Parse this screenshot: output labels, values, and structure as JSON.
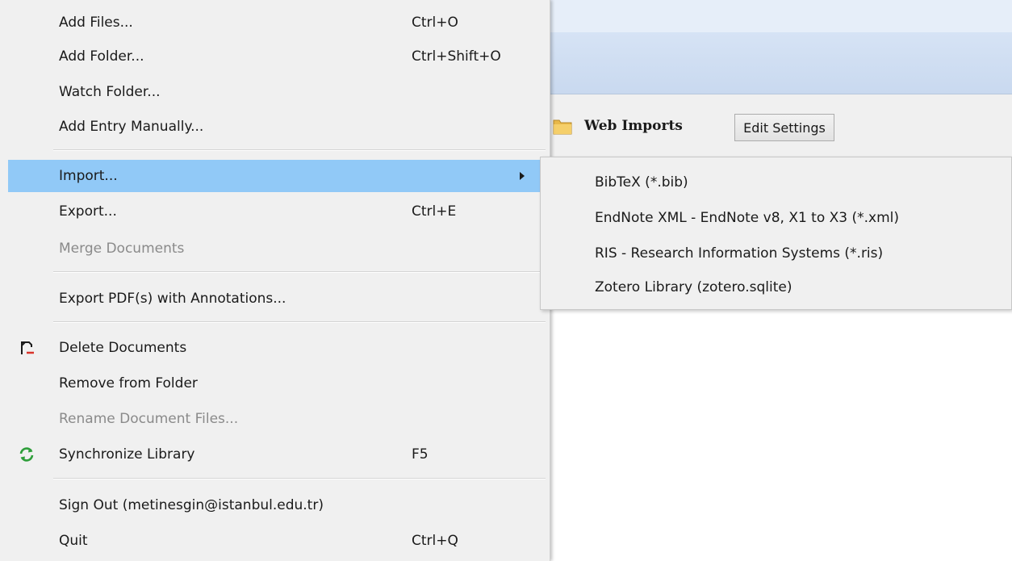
{
  "background": {
    "folder_title": "Web Imports",
    "edit_settings_label": "Edit Settings",
    "folder_icon": "folder-icon"
  },
  "menu": {
    "items": [
      {
        "label": "Add Files...",
        "shortcut": "Ctrl+O",
        "enabled": true
      },
      {
        "label": "Add Folder...",
        "shortcut": "Ctrl+Shift+O",
        "enabled": true
      },
      {
        "label": "Watch Folder...",
        "shortcut": "",
        "enabled": true
      },
      {
        "label": "Add Entry Manually...",
        "shortcut": "",
        "enabled": true
      },
      {
        "label": "Import...",
        "shortcut": "",
        "enabled": true,
        "highlighted": true,
        "has_submenu": true
      },
      {
        "label": "Export...",
        "shortcut": "Ctrl+E",
        "enabled": true
      },
      {
        "label": "Merge Documents",
        "shortcut": "",
        "enabled": false
      },
      {
        "label": "Export PDF(s) with Annotations...",
        "shortcut": "",
        "enabled": true
      },
      {
        "label": "Delete Documents",
        "shortcut": "",
        "enabled": true,
        "icon": "delete-document-icon"
      },
      {
        "label": "Remove from Folder",
        "shortcut": "",
        "enabled": true
      },
      {
        "label": "Rename Document Files...",
        "shortcut": "",
        "enabled": false
      },
      {
        "label": "Synchronize Library",
        "shortcut": "F5",
        "enabled": true,
        "icon": "sync-icon"
      },
      {
        "label": "Sign Out (metinesgin@istanbul.edu.tr)",
        "shortcut": "",
        "enabled": true
      },
      {
        "label": "Quit",
        "shortcut": "Ctrl+Q",
        "enabled": true
      }
    ]
  },
  "submenu": {
    "items": [
      {
        "label": "BibTeX (*.bib)"
      },
      {
        "label": "EndNote XML - EndNote v8, X1 to X3 (*.xml)"
      },
      {
        "label": "RIS - Research Information Systems (*.ris)"
      },
      {
        "label": "Zotero Library (zotero.sqlite)"
      }
    ]
  },
  "colors": {
    "highlight": "#91c9f7",
    "menu_background": "#f0f0f0",
    "disabled_text": "#8a8a8a",
    "sync_icon": "#2e9e3a",
    "delete_icon_accent": "#d9342b"
  }
}
